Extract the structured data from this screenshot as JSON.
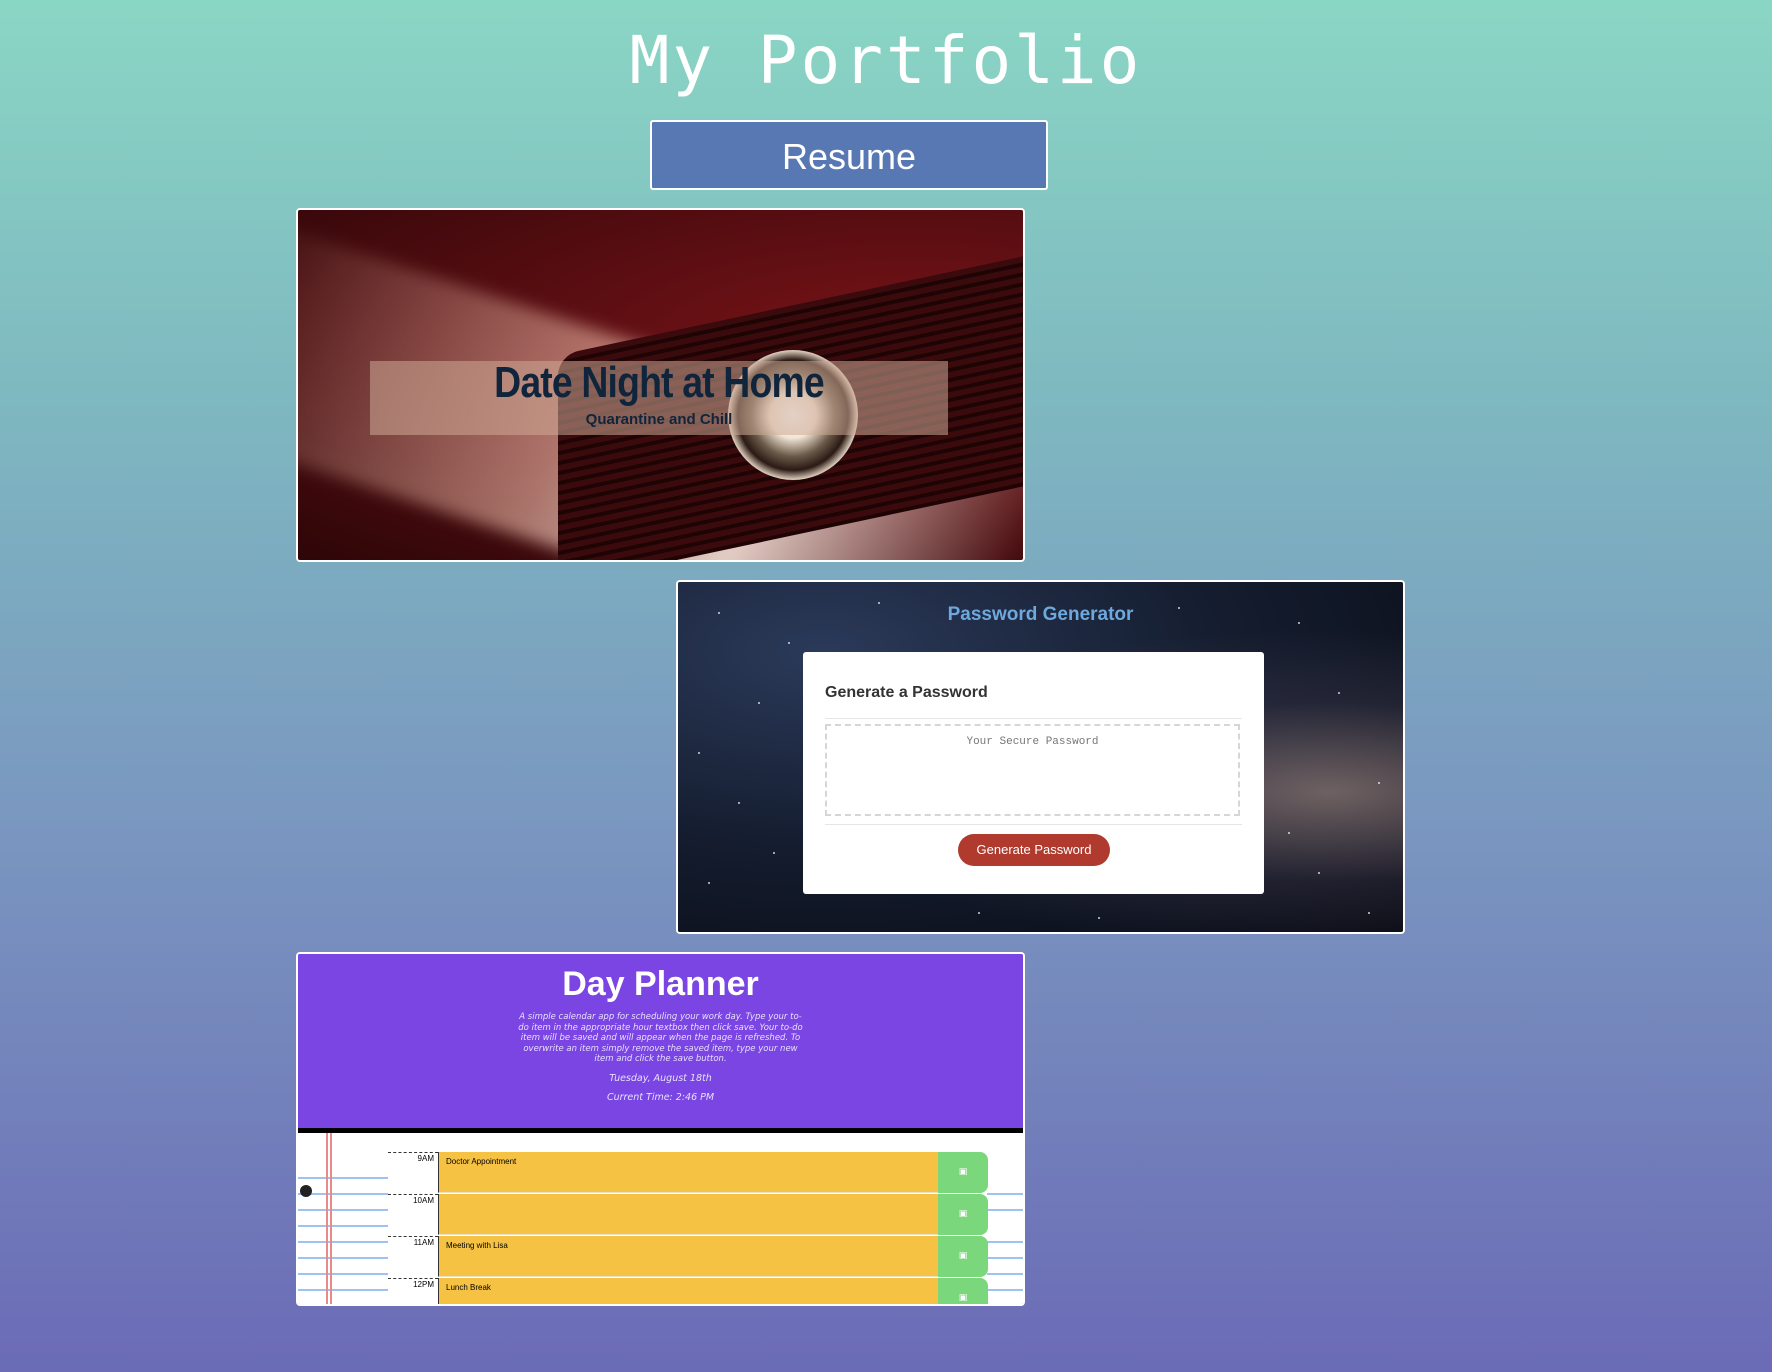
{
  "header": {
    "title": "My Portfolio",
    "resume_label": "Resume"
  },
  "projects": {
    "date_night": {
      "title": "Date Night at Home",
      "subtitle": "Quarantine and Chill"
    },
    "password_generator": {
      "header": "Password Generator",
      "panel_title": "Generate a Password",
      "output_placeholder": "Your Secure Password",
      "button_label": "Generate Password"
    },
    "day_planner": {
      "title": "Day Planner",
      "description": "A simple calendar app for scheduling your work day. Type your to-do item in the appropriate hour textbox then click save. Your to-do item will be saved and will appear when the page is refreshed. To overwrite an item simply remove the saved item, type your new item and click the save button.",
      "date": "Tuesday, August 18th",
      "time": "Current Time: 2:46 PM",
      "rows": [
        {
          "hour": "9AM",
          "task": "Doctor Appointment"
        },
        {
          "hour": "10AM",
          "task": ""
        },
        {
          "hour": "11AM",
          "task": "Meeting with Lisa"
        },
        {
          "hour": "12PM",
          "task": "Lunch Break"
        }
      ],
      "save_icon": "floppy-disk-icon"
    }
  },
  "colors": {
    "resume_button": "#5878b4",
    "planner_header": "#7a45e2",
    "planner_task": "#f5c244",
    "planner_save": "#7bd77b",
    "password_button": "#b03a2e",
    "password_header": "#6fa8dc"
  }
}
